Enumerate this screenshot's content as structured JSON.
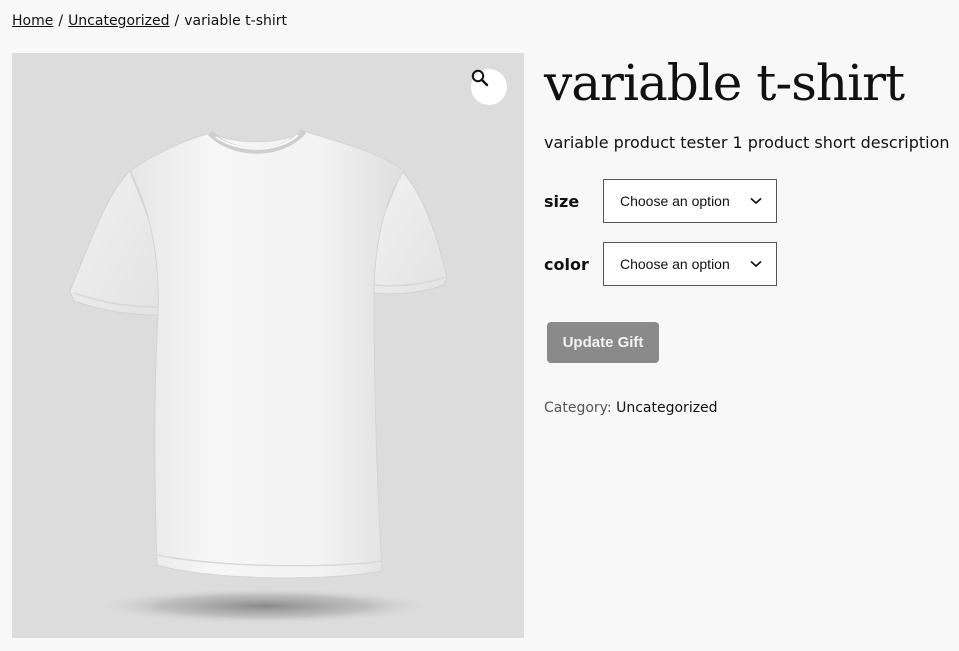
{
  "breadcrumb": {
    "items": [
      "Home",
      "Uncategorized"
    ],
    "separator": "/",
    "current": "variable t-shirt"
  },
  "gallery": {
    "image_alt": "white t-shirt",
    "zoom_icon": "magnifier-icon"
  },
  "product": {
    "title": "variable t-shirt",
    "short_description": "variable product tester 1 product short description"
  },
  "variations": [
    {
      "label": "size",
      "selected": "Choose an option"
    },
    {
      "label": "color",
      "selected": "Choose an option"
    }
  ],
  "actions": {
    "update_label": "Update Gift"
  },
  "meta": {
    "category_label": "Category:",
    "category_value": "Uncategorized"
  },
  "colors": {
    "background": "#f8f8f8",
    "image_background": "#dcdcdc",
    "button_disabled": "#8a8a8a"
  }
}
